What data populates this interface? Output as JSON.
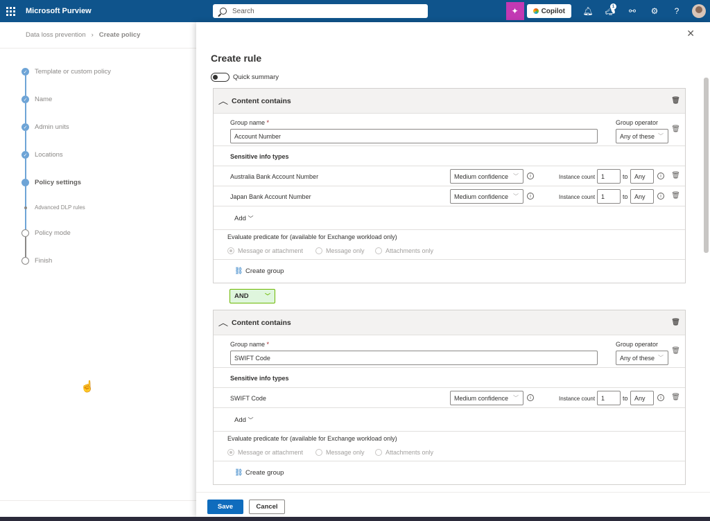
{
  "app": {
    "name": "Microsoft Purview"
  },
  "search": {
    "placeholder": "Search"
  },
  "topbar": {
    "copilot_label": "Copilot",
    "notification_count": "1"
  },
  "breadcrumb": {
    "parent": "Data loss prevention",
    "current": "Create policy"
  },
  "steps": [
    {
      "label": "Template or custom policy",
      "state": "done"
    },
    {
      "label": "Name",
      "state": "done"
    },
    {
      "label": "Admin units",
      "state": "done"
    },
    {
      "label": "Locations",
      "state": "done"
    },
    {
      "label": "Policy settings",
      "state": "current"
    },
    {
      "label": "Advanced DLP rules",
      "state": "sub"
    },
    {
      "label": "Policy mode",
      "state": "pending"
    },
    {
      "label": "Finish",
      "state": "pending"
    }
  ],
  "panel": {
    "title": "Create rule",
    "quick_summary_label": "Quick summary",
    "groups": [
      {
        "header": "Content contains",
        "group_name_label": "Group name",
        "group_name_value": "Account Number",
        "group_operator_label": "Group operator",
        "group_operator_value": "Any of these",
        "sit_header": "Sensitive info types",
        "sits": [
          {
            "name": "Australia Bank Account Number",
            "confidence": "Medium confidence",
            "instance_label": "Instance count",
            "min": "1",
            "to_label": "to",
            "max": "Any"
          },
          {
            "name": "Japan Bank Account Number",
            "confidence": "Medium confidence",
            "instance_label": "Instance count",
            "min": "1",
            "to_label": "to",
            "max": "Any"
          }
        ],
        "add_label": "Add",
        "predicate_label": "Evaluate predicate for (available for Exchange workload only)",
        "radios": [
          "Message or attachment",
          "Message only",
          "Attachments only"
        ],
        "create_group_label": "Create group"
      },
      {
        "header": "Content contains",
        "group_name_label": "Group name",
        "group_name_value": "SWIFT Code",
        "group_operator_label": "Group operator",
        "group_operator_value": "Any of these",
        "sit_header": "Sensitive info types",
        "sits": [
          {
            "name": "SWIFT Code",
            "confidence": "Medium confidence",
            "instance_label": "Instance count",
            "min": "1",
            "to_label": "to",
            "max": "Any"
          }
        ],
        "add_label": "Add",
        "predicate_label": "Evaluate predicate for (available for Exchange workload only)",
        "radios": [
          "Message or attachment",
          "Message only",
          "Attachments only"
        ],
        "create_group_label": "Create group"
      }
    ],
    "and_operator": "AND",
    "save_label": "Save",
    "cancel_label": "Cancel"
  },
  "colors": {
    "brand": "#0f548c",
    "accent": "#0f6cbd",
    "copilot": "#c239b3",
    "and_bg": "#dff6dd"
  }
}
